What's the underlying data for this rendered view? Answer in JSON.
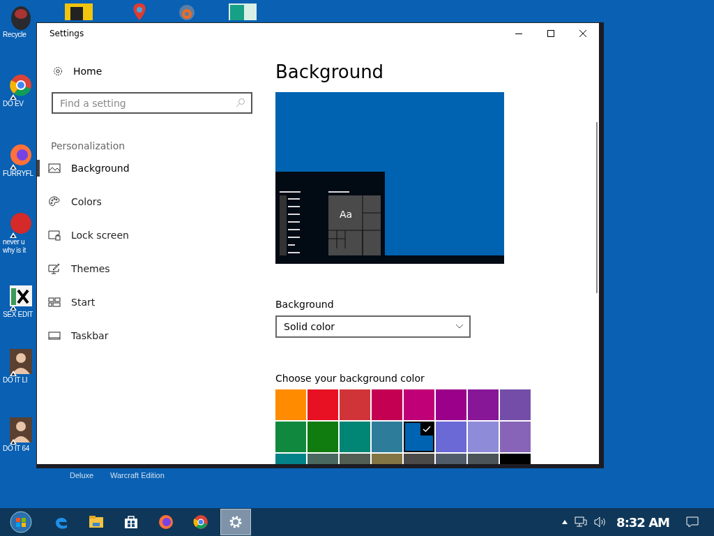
{
  "desktop": {
    "icons": [
      {
        "kind": "bin",
        "label": "Recycle",
        "shortcut": false
      },
      {
        "kind": "chrome",
        "label": "DO EV",
        "shortcut": true
      },
      {
        "kind": "firefox",
        "label": "FURRYFL",
        "shortcut": true
      },
      {
        "kind": "devcpp",
        "label": "never u why is it",
        "shortcut": true
      },
      {
        "kind": "hex",
        "label": "SEX EDIT",
        "shortcut": true
      },
      {
        "kind": "portrait",
        "label": "DO IT LI",
        "shortcut": true
      },
      {
        "kind": "portrait",
        "label": "DO IT 64",
        "shortcut": true
      }
    ],
    "top_icons": [
      {
        "kind": "yellow"
      },
      {
        "kind": "pin"
      },
      {
        "kind": "ring"
      },
      {
        "kind": "green"
      }
    ],
    "bottom_labels": [
      "Deluxe",
      "Warcraft Edition"
    ]
  },
  "window": {
    "title": "Settings"
  },
  "sidebar": {
    "home": "Home",
    "search": {
      "placeholder": "Find a setting"
    },
    "section": "Personalization",
    "items": [
      {
        "label": "Background",
        "selected": true
      },
      {
        "label": "Colors",
        "selected": false
      },
      {
        "label": "Lock screen",
        "selected": false
      },
      {
        "label": "Themes",
        "selected": false
      },
      {
        "label": "Start",
        "selected": false
      },
      {
        "label": "Taskbar",
        "selected": false
      }
    ]
  },
  "content": {
    "title": "Background",
    "preview": {
      "sample": "Aa"
    },
    "background_label": "Background",
    "background_select": {
      "value": "Solid color"
    },
    "color_heading": "Choose your background color",
    "colors": [
      {
        "color": "#ff8c00",
        "selected": false
      },
      {
        "color": "#e81123",
        "selected": false
      },
      {
        "color": "#d13438",
        "selected": false
      },
      {
        "color": "#c30052",
        "selected": false
      },
      {
        "color": "#bf0077",
        "selected": false
      },
      {
        "color": "#9a0089",
        "selected": false
      },
      {
        "color": "#881798",
        "selected": false
      },
      {
        "color": "#744da9",
        "selected": false
      },
      {
        "color": "#10893e",
        "selected": false
      },
      {
        "color": "#107c10",
        "selected": false
      },
      {
        "color": "#018574",
        "selected": false
      },
      {
        "color": "#2d7d9a",
        "selected": false
      },
      {
        "color": "#0063b1",
        "selected": true
      },
      {
        "color": "#6b69d6",
        "selected": false
      },
      {
        "color": "#8e8cd8",
        "selected": false
      },
      {
        "color": "#8764b8",
        "selected": false
      },
      {
        "color": "#038387",
        "selected": false
      },
      {
        "color": "#486860",
        "selected": false
      },
      {
        "color": "#525e54",
        "selected": false
      },
      {
        "color": "#847545",
        "selected": false
      },
      {
        "color": "#4c4a48",
        "selected": false
      },
      {
        "color": "#515c6b",
        "selected": false
      },
      {
        "color": "#4a5459",
        "selected": false
      },
      {
        "color": "#000000",
        "selected": false
      }
    ]
  },
  "taskbar": {
    "apps": [
      {
        "kind": "edge",
        "active": false
      },
      {
        "kind": "explorer",
        "active": false
      },
      {
        "kind": "store",
        "active": false
      },
      {
        "kind": "firefox",
        "active": false
      },
      {
        "kind": "chrome",
        "active": false
      },
      {
        "kind": "settings",
        "active": true
      }
    ],
    "clock": "8:32 AM"
  }
}
